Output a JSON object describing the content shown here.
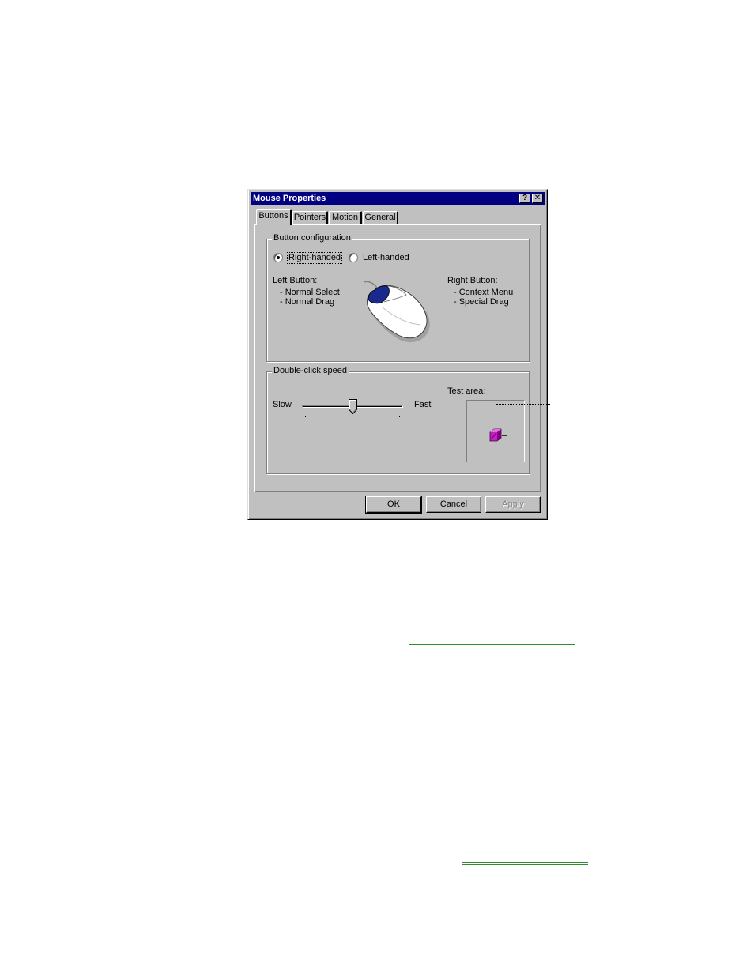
{
  "window": {
    "title": "Mouse Properties",
    "help_label": "?",
    "close_label": "✕"
  },
  "tabs": [
    {
      "label": "Buttons",
      "active": true
    },
    {
      "label": "Pointers"
    },
    {
      "label": "Motion"
    },
    {
      "label": "General"
    }
  ],
  "button_config": {
    "legend": "Button configuration",
    "right_handed_label": "Right-handed",
    "left_handed_label": "Left-handed",
    "selected": "right-handed",
    "left_button": {
      "heading": "Left Button:",
      "items": [
        "- Normal Select",
        "- Normal Drag"
      ]
    },
    "right_button": {
      "heading": "Right Button:",
      "items": [
        "- Context Menu",
        "- Special Drag"
      ]
    }
  },
  "double_click": {
    "legend": "Double-click speed",
    "slow_label": "Slow",
    "fast_label": "Fast",
    "slider_value_fraction": 0.5,
    "test_area_label": "Test area:"
  },
  "buttons": {
    "ok": "OK",
    "cancel": "Cancel",
    "apply": "Apply"
  },
  "colors": {
    "title_bar": "#000080",
    "face": "#c0c0c0",
    "mouse_button": "#1a2a8c",
    "jack_in_box": "#c020c0",
    "annotation_line": "#2f8f2f"
  }
}
